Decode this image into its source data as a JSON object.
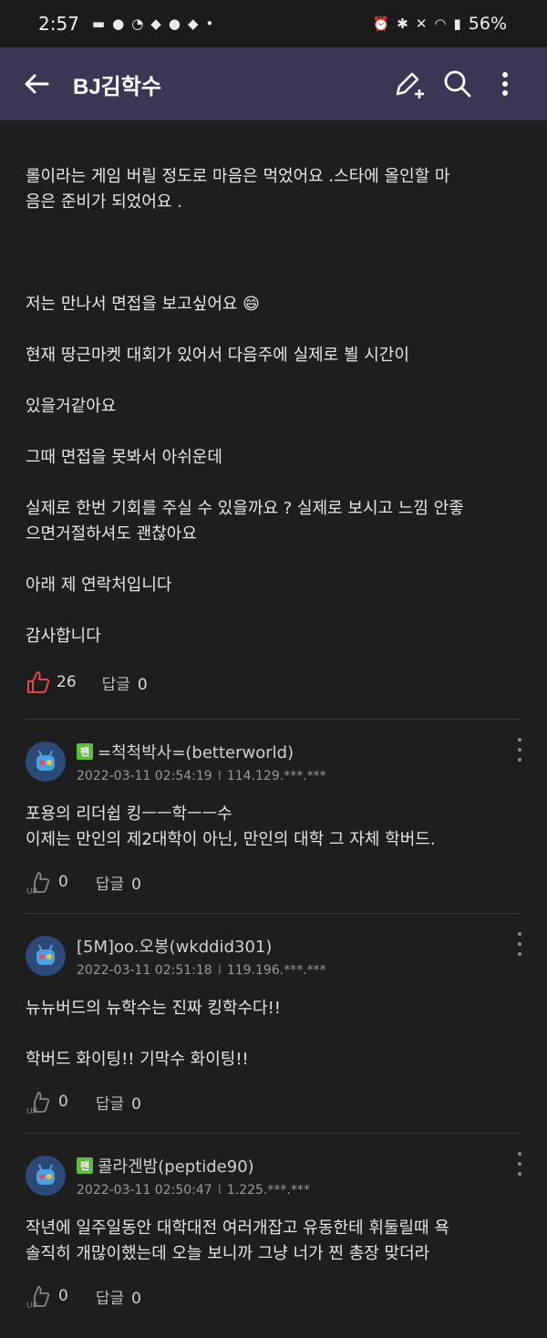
{
  "status": {
    "time": "2:57",
    "battery": "56%"
  },
  "appbar": {
    "title": "BJ김학수"
  },
  "post": {
    "para1_line1": "롤이라는 게임 버릴 정도로 마음은 먹었어요 .스타에 올인할 마",
    "para1_line2": "음은 준비가 되었어요 .",
    "para2": "저는 만나서 면접을 보고싶어요 😄",
    "para3": "현재 땅근마켓 대회가 있어서 다음주에 실제로 뵐 시간이",
    "para4": "있을거같아요",
    "para5": "그때 면접을 못봐서 아쉬운데",
    "para6_line1": "실제로 한번 기회를 주실 수 있을까요 ? 실제로 보시고 느낌 안좋",
    "para6_line2": "으면거절하셔도 괜찮아요",
    "para7": "아래 제 연락처입니다",
    "para8": "감사합니다",
    "likes": "26",
    "reply_label": "답글",
    "reply_count": "0"
  },
  "comments": [
    {
      "fan": true,
      "fan_label": "팬",
      "name": "=척척박사=(betterworld)",
      "date": "2022-03-11 02:54:19",
      "ip": "114.129.***.***",
      "line1": "포용의 리더쉽 킹ㅡㅡ학ㅡㅡ수",
      "line2": "이제는 만인의 제2대학이 아닌, 만인의 대학 그 자체 학버드.",
      "likes": "0",
      "reply_label": "답글",
      "reply_count": "0"
    },
    {
      "fan": false,
      "name": "[5M]oo.오봉(wkddid301)",
      "date": "2022-03-11 02:51:18",
      "ip": "119.196.***.***",
      "line1": "뉴뉴버드의 뉴학수는 진짜 킹학수다!!",
      "line2": "학버드 화이팅!! 기막수 화이팅!!",
      "likes": "0",
      "reply_label": "답글",
      "reply_count": "0"
    },
    {
      "fan": true,
      "fan_label": "팬",
      "name": "콜라겐밤(peptide90)",
      "date": "2022-03-11 02:50:47",
      "ip": "1.225.***.***",
      "line1": "작년에 일주일동안 대학대전 여러개잡고 유동한테 휘둘릴때 욕",
      "line2": "솔직히 개많이했는데 오늘 보니까 그냥 너가 찐 총장 맞더라",
      "likes": "0",
      "reply_label": "답글",
      "reply_count": "0"
    }
  ]
}
